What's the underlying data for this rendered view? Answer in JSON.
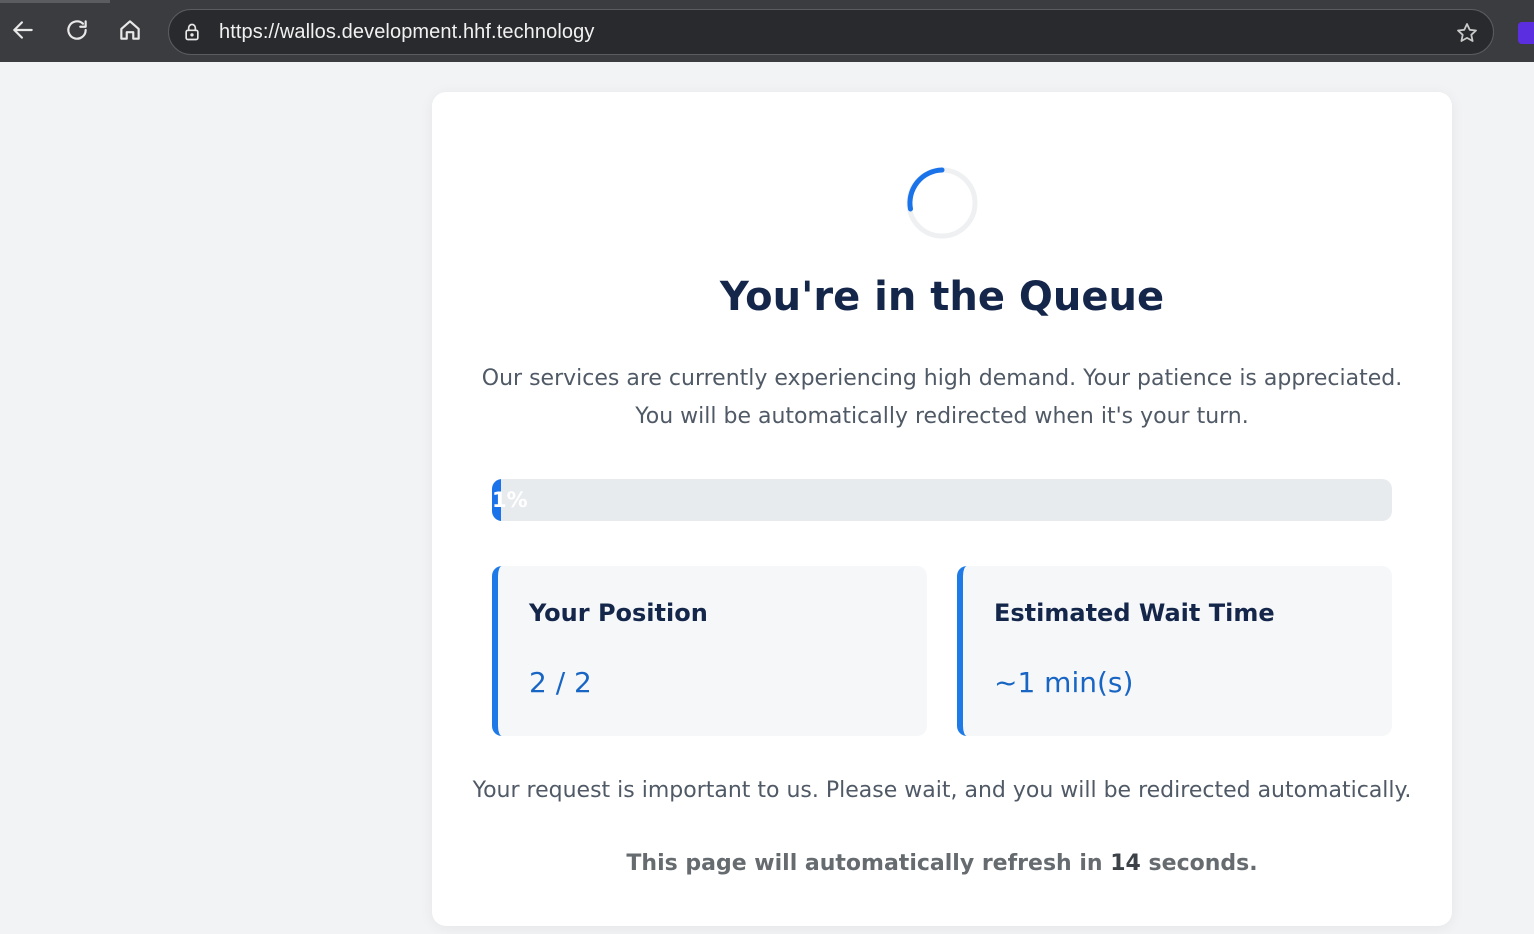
{
  "browser": {
    "url": "https://wallos.development.hhf.technology",
    "icons": {
      "back": "back-arrow-icon",
      "reload": "reload-icon",
      "home": "home-icon",
      "site_info": "lock-icon",
      "bookmark": "star-icon"
    }
  },
  "queue": {
    "title": "You're in the Queue",
    "description_line1": "Our services are currently experiencing high demand. Your patience is appreciated.",
    "description_line2": "You will be automatically redirected when it's your turn.",
    "progress": {
      "percent": 1,
      "label": "1%"
    },
    "position": {
      "label": "Your Position",
      "value": "2 / 2"
    },
    "wait_time": {
      "label": "Estimated Wait Time",
      "value": "~1 min(s)"
    },
    "note": "Your request is important to us. Please wait, and you will be redirected automatically.",
    "refresh": {
      "prefix": "This page will automatically refresh in",
      "seconds": "14",
      "suffix": "seconds."
    }
  },
  "colors": {
    "accent": "#1a73e8",
    "title": "#14264a",
    "card_bg": "#ffffff",
    "page_bg": "#f2f3f5",
    "stat_bg": "#f5f7f9",
    "progress_track": "#e8ebee",
    "value_text": "#1865c4"
  }
}
